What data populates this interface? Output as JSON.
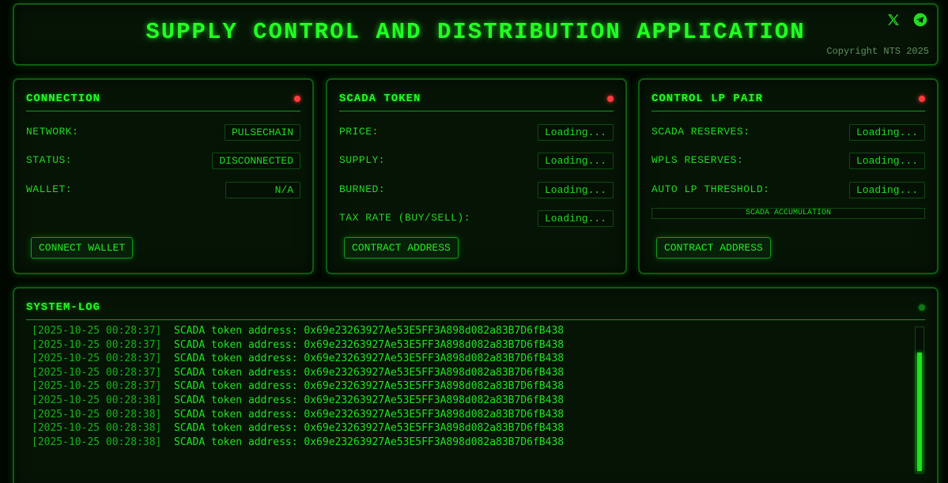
{
  "header": {
    "title": "SUPPLY CONTROL AND DISTRIBUTION APPLICATION",
    "copyright": "Copyright NTS 2025",
    "icons": [
      "x-icon",
      "telegram-icon"
    ]
  },
  "connection": {
    "title": "CONNECTION",
    "network_label": "NETWORK:",
    "network_value": "PULSECHAIN",
    "status_label": "STATUS:",
    "status_value": "DISCONNECTED",
    "wallet_label": "WALLET:",
    "wallet_value": "N/A",
    "button": "CONNECT WALLET",
    "indicator_color": "#ff3b3b"
  },
  "token": {
    "title": "SCADA TOKEN",
    "price_label": "PRICE:",
    "price_value": "Loading...",
    "supply_label": "SUPPLY:",
    "supply_value": "Loading...",
    "burned_label": "BURNED:",
    "burned_value": "Loading...",
    "tax_label": "TAX RATE (BUY/SELL):",
    "tax_value": "Loading...",
    "button": "CONTRACT ADDRESS",
    "indicator_color": "#ff3b3b"
  },
  "lp": {
    "title": "CONTROL LP PAIR",
    "scada_label": "SCADA RESERVES:",
    "scada_value": "Loading...",
    "wpls_label": "WPLS RESERVES:",
    "wpls_value": "Loading...",
    "threshold_label": "AUTO LP THRESHOLD:",
    "threshold_value": "Loading...",
    "accumulation": "SCADA ACCUMULATION",
    "button": "CONTRACT ADDRESS",
    "indicator_color": "#ff3b3b"
  },
  "syslog": {
    "title": "SYSTEM-LOG",
    "indicator_color": "#0e7a14",
    "lines": [
      {
        "ts": "[2025-10-25 00:28:37]",
        "msg": "SCADA token address: 0x69e23263927Ae53E5FF3A898d082a83B7D6fB438"
      },
      {
        "ts": "[2025-10-25 00:28:37]",
        "msg": "SCADA token address: 0x69e23263927Ae53E5FF3A898d082a83B7D6fB438"
      },
      {
        "ts": "[2025-10-25 00:28:37]",
        "msg": "SCADA token address: 0x69e23263927Ae53E5FF3A898d082a83B7D6fB438"
      },
      {
        "ts": "[2025-10-25 00:28:37]",
        "msg": "SCADA token address: 0x69e23263927Ae53E5FF3A898d082a83B7D6fB438"
      },
      {
        "ts": "[2025-10-25 00:28:37]",
        "msg": "SCADA token address: 0x69e23263927Ae53E5FF3A898d082a83B7D6fB438"
      },
      {
        "ts": "[2025-10-25 00:28:38]",
        "msg": "SCADA token address: 0x69e23263927Ae53E5FF3A898d082a83B7D6fB438"
      },
      {
        "ts": "[2025-10-25 00:28:38]",
        "msg": "SCADA token address: 0x69e23263927Ae53E5FF3A898d082a83B7D6fB438"
      },
      {
        "ts": "[2025-10-25 00:28:38]",
        "msg": "SCADA token address: 0x69e23263927Ae53E5FF3A898d082a83B7D6fB438"
      },
      {
        "ts": "[2025-10-25 00:28:38]",
        "msg": "SCADA token address: 0x69e23263927Ae53E5FF3A898d082a83B7D6fB438"
      }
    ]
  }
}
